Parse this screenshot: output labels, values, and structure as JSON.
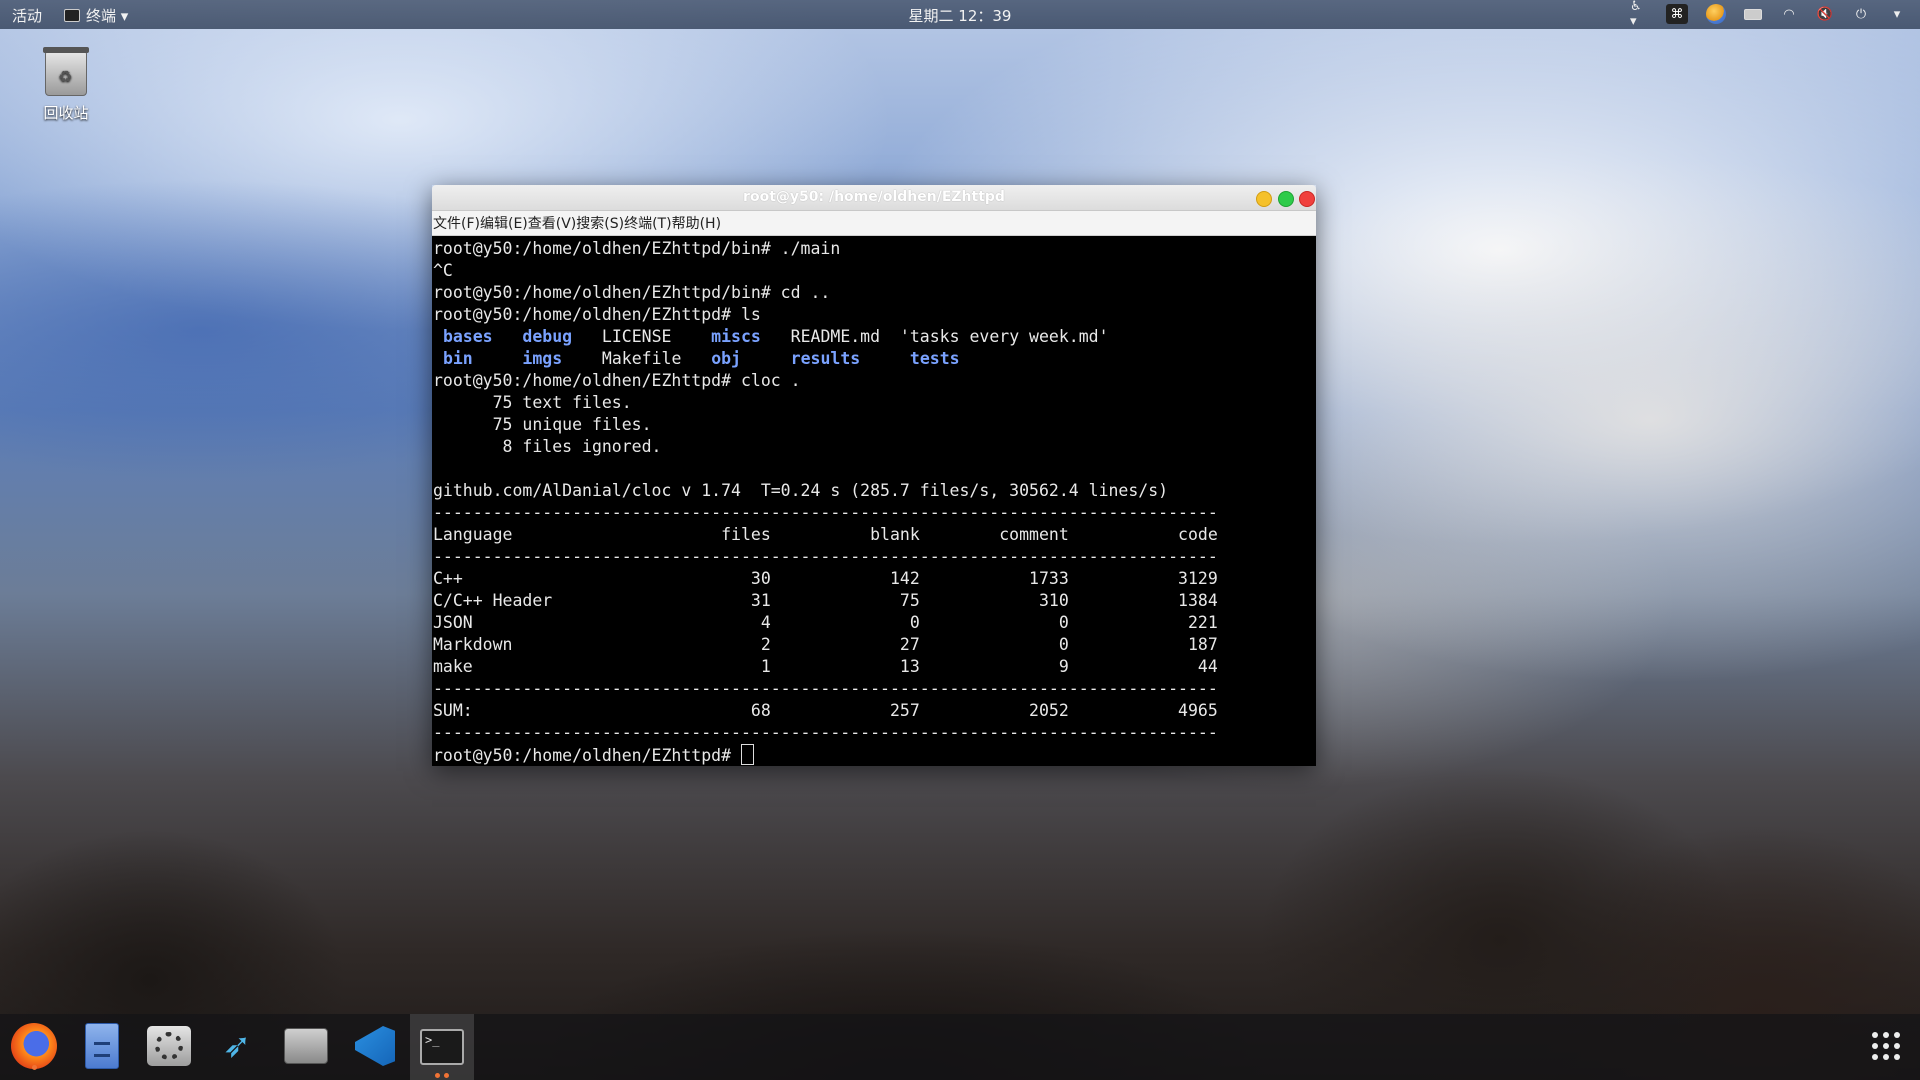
{
  "topbar": {
    "activities": "活动",
    "app_menu": "终端 ▾",
    "clock": "星期二 12：39"
  },
  "desktop": {
    "trash_label": "回收站"
  },
  "terminal": {
    "title": "root@y50: /home/oldhen/EZhttpd",
    "menu": [
      "文件(F)",
      "编辑(E)",
      "查看(V)",
      "搜索(S)",
      "终端(T)",
      "帮助(H)"
    ],
    "lines": [
      "root@y50:/home/oldhen/EZhttpd/bin# ./main",
      "^C",
      "root@y50:/home/oldhen/EZhttpd/bin# cd ..",
      "root@y50:/home/oldhen/EZhttpd# ls",
      "LS1",
      "LS2",
      "root@y50:/home/oldhen/EZhttpd# cloc .",
      "      75 text files.",
      "      75 unique files.",
      "       8 files ignored.",
      "",
      "github.com/AlDanial/cloc v 1.74  T=0.24 s (285.7 files/s, 30562.4 lines/s)",
      "-------------------------------------------------------------------------------",
      "Language                     files          blank        comment           code",
      "-------------------------------------------------------------------------------",
      "C++                             30            142           1733           3129",
      "C/C++ Header                    31             75            310           1384",
      "JSON                             4              0              0            221",
      "Markdown                         2             27              0            187",
      "make                             1             13              9             44",
      "-------------------------------------------------------------------------------",
      "SUM:                            68            257           2052           4965",
      "-------------------------------------------------------------------------------",
      "PROMPT"
    ],
    "ls_row1": [
      {
        "t": " ",
        "dir": false
      },
      {
        "t": "bases",
        "dir": true
      },
      {
        "t": "   ",
        "dir": false
      },
      {
        "t": "debug",
        "dir": true
      },
      {
        "t": "   LICENSE    ",
        "dir": false
      },
      {
        "t": "miscs",
        "dir": true
      },
      {
        "t": "   README.md  'tasks every week.md'",
        "dir": false
      }
    ],
    "ls_row2": [
      {
        "t": " ",
        "dir": false
      },
      {
        "t": "bin",
        "dir": true
      },
      {
        "t": "     ",
        "dir": false
      },
      {
        "t": "imgs",
        "dir": true
      },
      {
        "t": "    Makefile   ",
        "dir": false
      },
      {
        "t": "obj",
        "dir": true
      },
      {
        "t": "     ",
        "dir": false
      },
      {
        "t": "results",
        "dir": true
      },
      {
        "t": "     ",
        "dir": false
      },
      {
        "t": "tests",
        "dir": true
      }
    ],
    "prompt": "root@y50:/home/oldhen/EZhttpd# "
  },
  "dock": {
    "items": [
      "firefox-icon",
      "files-icon",
      "settings-icon",
      "bird-icon",
      "package-icon",
      "vscode-icon",
      "terminal-icon"
    ],
    "terminal_glyph": ">_"
  },
  "colors": {
    "dir_blue": "#7aa2ff",
    "close": "#f0403d",
    "minimize": "#f5c12b",
    "maximize": "#2ecb4a"
  }
}
